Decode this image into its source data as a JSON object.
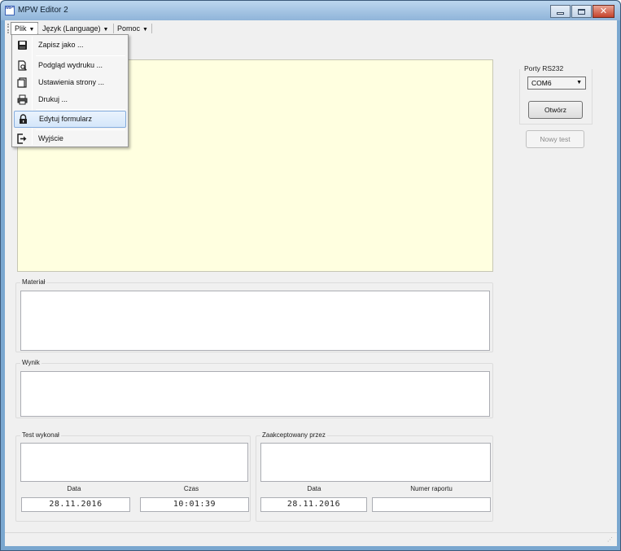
{
  "window": {
    "title": "MPW Editor 2",
    "icon_text": "MPW"
  },
  "menubar": {
    "items": [
      {
        "label": "Plik"
      },
      {
        "label": "Język (Language)"
      },
      {
        "label": "Pomoc"
      }
    ]
  },
  "file_menu": {
    "items": [
      {
        "label": "Zapisz jako ...",
        "icon": "save-icon"
      },
      {
        "label": "Podgląd wydruku ...",
        "icon": "print-preview-icon"
      },
      {
        "label": "Ustawienia strony ...",
        "icon": "page-setup-icon"
      },
      {
        "label": "Drukuj ...",
        "icon": "printer-icon"
      },
      {
        "label": "Edytuj formularz",
        "icon": "lock-icon"
      },
      {
        "label": "Wyjście",
        "icon": "exit-icon"
      }
    ],
    "highlighted_index": 4
  },
  "form": {
    "material": {
      "title": "Materiał",
      "value": ""
    },
    "result": {
      "title": "Wynik",
      "value": ""
    },
    "tested_by": {
      "title": "Test wykonał",
      "date_label": "Data",
      "date_value": "28.11.2016",
      "time_label": "Czas",
      "time_value": "10:01:39"
    },
    "accepted_by": {
      "title": "Zaakceptowany przez",
      "date_label": "Data",
      "date_value": "28.11.2016",
      "report_label": "Numer raportu",
      "report_value": ""
    }
  },
  "ports": {
    "title": "Porty RS232",
    "selected": "COM6",
    "open_button": "Otwórz",
    "new_test_button": "Nowy test"
  },
  "colors": {
    "editor_background": "#ffffe0",
    "menu_highlight": "#d4e6fa",
    "window_frame": "#7aa7cf"
  }
}
